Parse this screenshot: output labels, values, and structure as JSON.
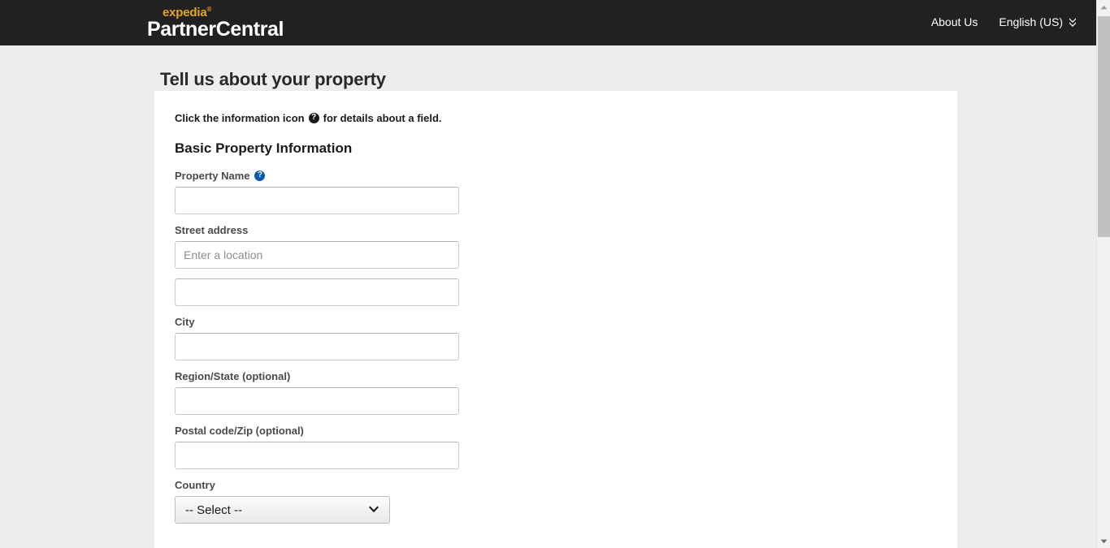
{
  "header": {
    "brand_top": "expedia",
    "brand_trademark": "®",
    "brand_bottom": "PartnerCentral",
    "nav": {
      "about_us": "About Us",
      "language": "English (US)",
      "language_icon": "double-chevron-down-icon"
    }
  },
  "page": {
    "title": "Tell us about your property"
  },
  "card": {
    "instruction_prefix": "Click the information icon",
    "instruction_icon": "question-mark-circle-icon",
    "instruction_suffix": "for details about a field.",
    "section_heading": "Basic Property Information"
  },
  "form": {
    "fields": [
      {
        "label": "Property Name",
        "info_icon": "question-mark-circle-icon-blue",
        "has_info": true,
        "type": "text",
        "value": "",
        "placeholder": ""
      },
      {
        "label": "Street address",
        "has_info": false,
        "type": "text",
        "value": "",
        "placeholder": "Enter a location"
      },
      {
        "label": "",
        "has_info": false,
        "type": "text",
        "value": "",
        "placeholder": ""
      },
      {
        "label": "City",
        "has_info": false,
        "type": "text",
        "value": "",
        "placeholder": ""
      },
      {
        "label": "Region/State (optional)",
        "has_info": false,
        "type": "text",
        "value": "",
        "placeholder": ""
      },
      {
        "label": "Postal code/Zip (optional)",
        "has_info": false,
        "type": "text",
        "value": "",
        "placeholder": ""
      },
      {
        "label": "Country",
        "has_info": false,
        "type": "select",
        "value": "-- Select --",
        "options": [
          "-- Select --"
        ]
      }
    ]
  },
  "scrollbar": {
    "up_icon": "triangle-up-icon",
    "down_icon": "triangle-down-icon",
    "thumb": "scrollbar-thumb"
  },
  "colors": {
    "header_bg": "#22211f",
    "brand_accent": "#e6a817",
    "page_bg": "#ededed",
    "card_bg": "#ffffff",
    "info_blue": "#0a5ab5"
  }
}
